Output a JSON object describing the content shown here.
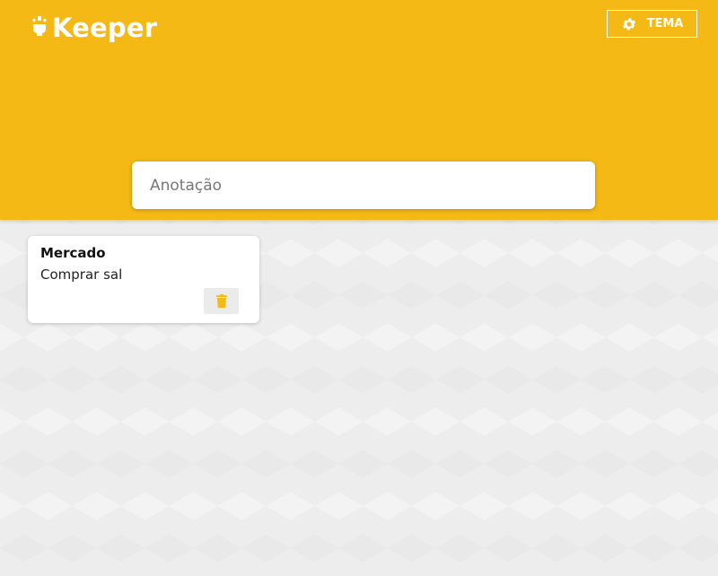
{
  "header": {
    "app_name": "Keeper",
    "theme_button_label": "TEMA",
    "brand_color": "#f4b915"
  },
  "composer": {
    "placeholder": "Anotação",
    "value": ""
  },
  "notes": [
    {
      "title": "Mercado",
      "content": "Comprar sal",
      "delete_icon": "trash-icon",
      "accent_color": "#f4b915"
    }
  ],
  "icons": {
    "logo": "lightbulb-icon",
    "theme": "gear-icon",
    "delete": "trash-icon"
  }
}
